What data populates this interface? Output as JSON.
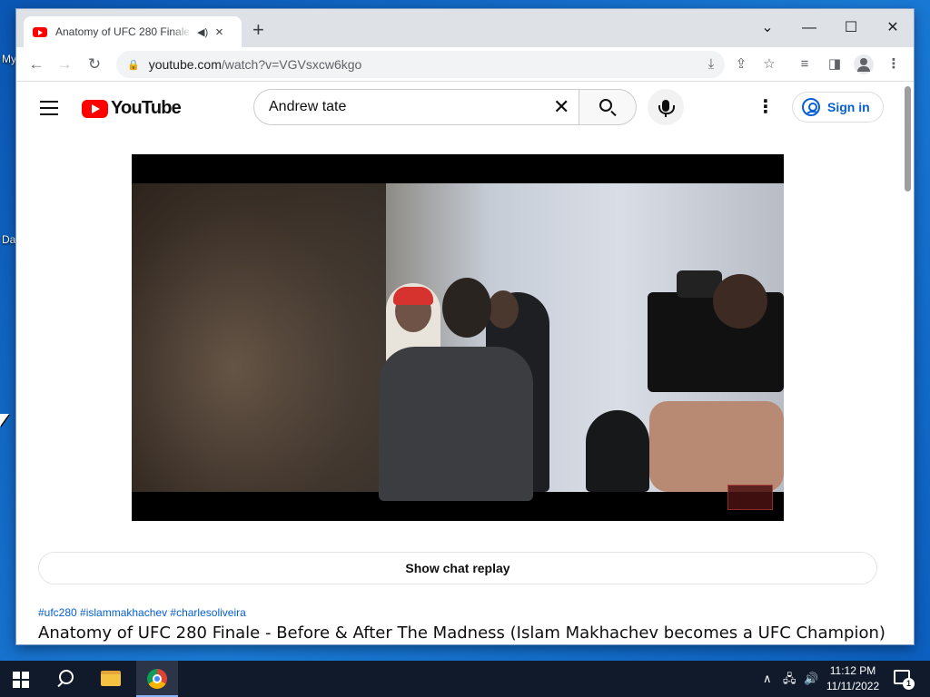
{
  "desktop": {
    "labels": [
      "My",
      "Da"
    ]
  },
  "browser": {
    "tab": {
      "title": "Anatomy of UFC 280 Finale -",
      "audio_icon": "speaker-icon",
      "close": "×"
    },
    "new_tab": "+",
    "url": {
      "host": "youtube.com",
      "path": "/watch?v=VGVsxcw6kgo"
    },
    "window_controls": {
      "tab_search": "⌄",
      "minimize": "—",
      "maximize": "☐",
      "close": "✕"
    },
    "nav": {
      "back": "←",
      "forward": "→",
      "reload": "↻"
    }
  },
  "youtube": {
    "logo_text": "YouTube",
    "search": {
      "value": "Andrew tate",
      "clear": "✕"
    },
    "sign_in": "Sign in",
    "chat_replay": "Show chat replay",
    "hashtags": "#ufc280 #islammakhachev #charlesoliveira",
    "video_title": "Anatomy of UFC 280 Finale - Before & After The Madness (Islam Makhachev becomes a UFC Champion)"
  },
  "taskbar": {
    "time": "11:12 PM",
    "date": "11/11/2022",
    "notification_count": "1",
    "tray": {
      "chevron": "∧",
      "network": "🖧",
      "volume": "🔊"
    }
  },
  "colors": {
    "accent_blue": "#065fd4",
    "youtube_red": "#ff0000",
    "taskbar_bg": "#101a2b"
  }
}
